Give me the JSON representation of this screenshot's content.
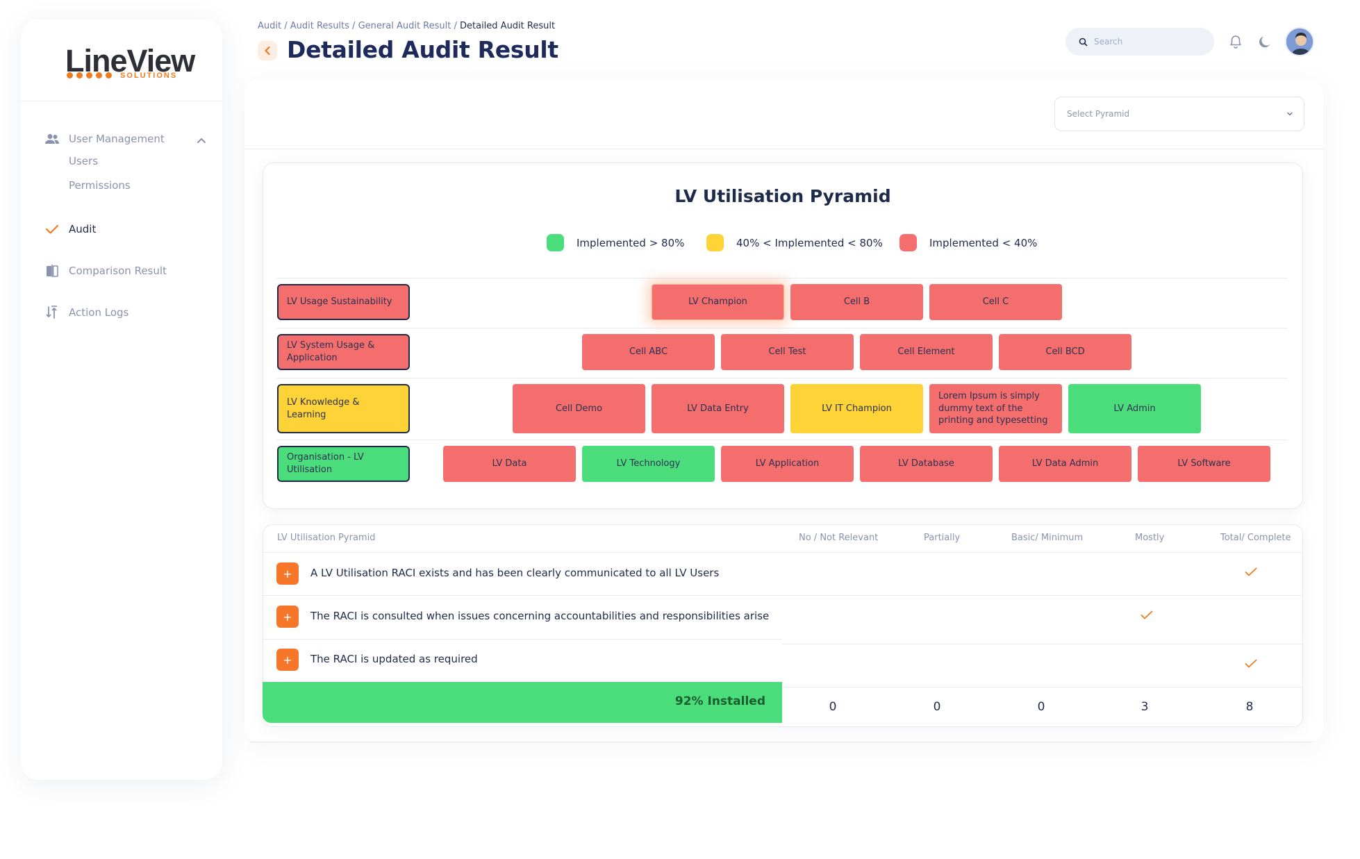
{
  "brand": {
    "name": "LineView",
    "sub": "SOLUTIONS"
  },
  "sidebar": {
    "user_management": "User Management",
    "users": "Users",
    "permissions": "Permissions",
    "audit": "Audit",
    "comparison": "Comparison Result",
    "action_logs": "Action Logs"
  },
  "breadcrumb": {
    "items": [
      "Audit",
      "Audit Results",
      "General Audit Result"
    ],
    "current": "Detailed Audit Result",
    "sep": " / "
  },
  "page": {
    "title": "Detailed Audit Result"
  },
  "header": {
    "search_placeholder": "Search"
  },
  "filter": {
    "select_placeholder": "Select Pyramid"
  },
  "pyramid": {
    "title": "LV Utilisation Pyramid",
    "legend": [
      "Implemented > 80%",
      "40% < Implemented < 80%",
      "Implemented < 40%"
    ],
    "colors": {
      "green": "#4bdd7c",
      "yellow": "#fdd338",
      "red": "#f46e6e"
    },
    "rows": [
      {
        "label": "LV Usage Sustainability",
        "status": "red",
        "cells": [
          {
            "t": "LV Champion",
            "s": "red"
          },
          {
            "t": "Cell B",
            "s": "red"
          },
          {
            "t": "Cell C",
            "s": "red"
          }
        ]
      },
      {
        "label": "LV System Usage & Application",
        "status": "red",
        "cells": [
          {
            "t": "Cell ABC",
            "s": "red"
          },
          {
            "t": "Cell Test",
            "s": "red"
          },
          {
            "t": "Cell Element",
            "s": "red"
          },
          {
            "t": "Cell BCD",
            "s": "red"
          }
        ]
      },
      {
        "label": "LV Knowledge & Learning",
        "status": "yellow",
        "cells": [
          {
            "t": "Cell Demo",
            "s": "red"
          },
          {
            "t": "LV Data Entry",
            "s": "red"
          },
          {
            "t": "LV IT Champion",
            "s": "yellow"
          },
          {
            "t": "Lorem Ipsum is simply dummy text of the printing and typesetting",
            "s": "red"
          },
          {
            "t": "LV Admin",
            "s": "green"
          }
        ]
      },
      {
        "label": "Organisation - LV Utilisation",
        "status": "green",
        "cells": [
          {
            "t": "LV Data",
            "s": "red"
          },
          {
            "t": "LV Technology",
            "s": "green"
          },
          {
            "t": "LV Application",
            "s": "red"
          },
          {
            "t": "LV Database",
            "s": "red"
          },
          {
            "t": "LV Data Admin",
            "s": "red"
          },
          {
            "t": "LV Software",
            "s": "red"
          }
        ]
      }
    ]
  },
  "table": {
    "headers": [
      "LV Utilisation Pyramid",
      "No / Not Relevant",
      "Partially",
      "Basic/ Minimum",
      "Mostly",
      "Total/ Complete"
    ],
    "rows": [
      {
        "text": "A LV Utilisation RACI exists and has been clearly communicated to all LV Users",
        "answer": "Total/ Complete"
      },
      {
        "text": "The RACI is consulted when issues concerning accountabilities and responsibilities arise",
        "answer": "Mostly"
      },
      {
        "text": "The RACI is updated as required",
        "answer": "Total/ Complete"
      }
    ],
    "expand_label": "+",
    "installed": "92% Installed",
    "totals": [
      "0",
      "0",
      "0",
      "3",
      "8"
    ]
  }
}
